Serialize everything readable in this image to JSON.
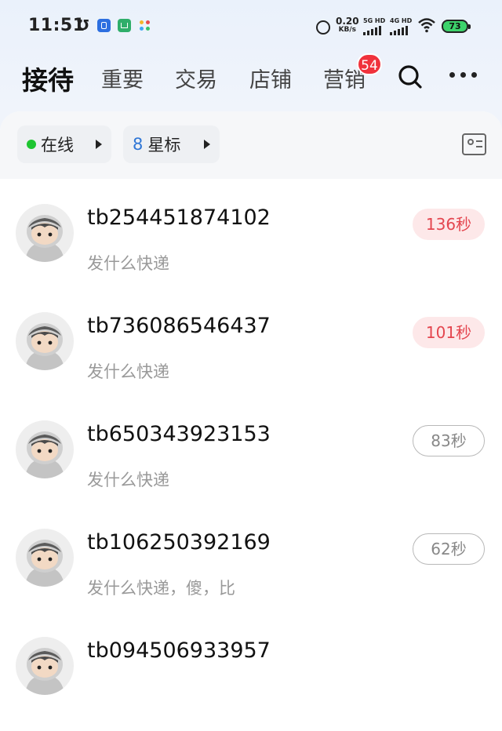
{
  "status_bar": {
    "time": "11:51",
    "net_speed_value": "0.20",
    "net_speed_unit": "KB/s",
    "sim1_label": "5G HD",
    "sim2_label": "4G HD",
    "battery_level": "73",
    "icons": [
      "mini-u-icon",
      "app-icon-blue",
      "app-icon-green",
      "app-icon-colorful",
      "alarm-icon",
      "signal-icon",
      "wifi-icon",
      "battery-icon"
    ]
  },
  "header": {
    "tabs": [
      {
        "label": "接待",
        "active": true
      },
      {
        "label": "重要"
      },
      {
        "label": "交易"
      },
      {
        "label": "店铺"
      },
      {
        "label": "营销",
        "badge": "54"
      }
    ],
    "icons": [
      "search-icon",
      "more-icon"
    ]
  },
  "filters": {
    "status_label": "在线",
    "star_count": "8",
    "star_label": "星标",
    "icons": [
      "status-dot",
      "dropdown-arrow-icon",
      "contact-card-icon"
    ]
  },
  "conversations": [
    {
      "user": "tb254451874102",
      "message": "发什么快递",
      "wait": "136秒",
      "urgent": true
    },
    {
      "user": "tb736086546437",
      "message": "发什么快递",
      "wait": "101秒",
      "urgent": true
    },
    {
      "user": "tb650343923153",
      "message": "发什么快递",
      "wait": "83秒",
      "urgent": false
    },
    {
      "user": "tb106250392169",
      "message": "发什么快递，傻，比",
      "wait": "62秒",
      "urgent": false
    },
    {
      "user": "tb094506933957",
      "message": "",
      "wait": "",
      "urgent": false
    }
  ],
  "colors": {
    "urgent_text": "#e4464f",
    "urgent_bg": "#fde8e9",
    "online_dot": "#1ec531",
    "badge": "#f0323c",
    "star_count": "#2f76d6"
  }
}
